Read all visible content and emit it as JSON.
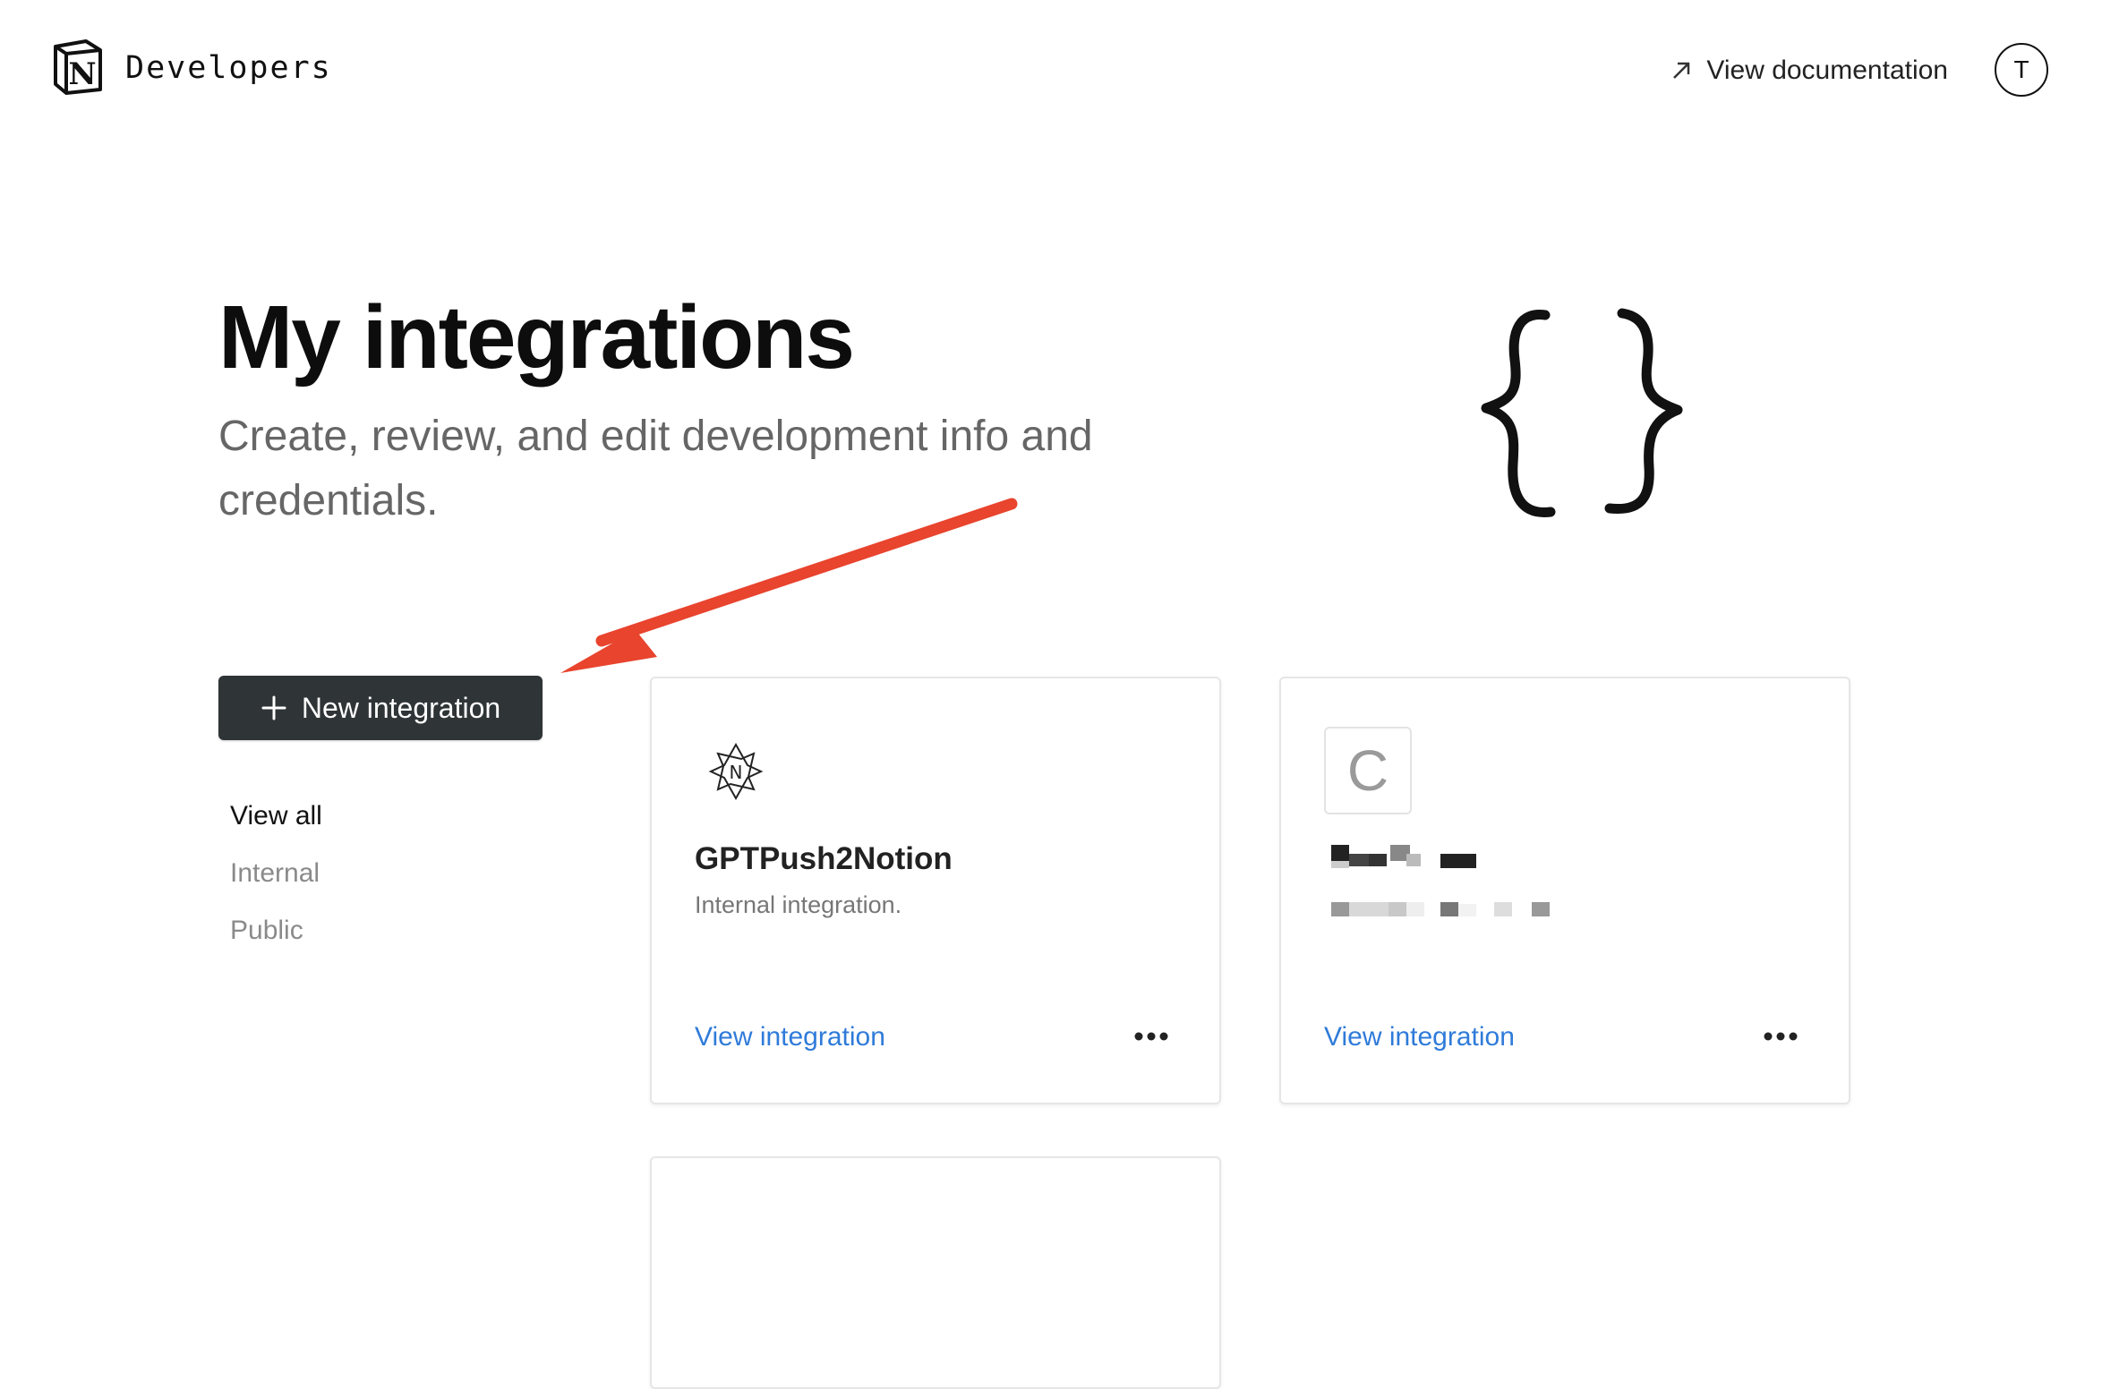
{
  "header": {
    "brand": "Developers",
    "doc_link": "View documentation",
    "avatar_letter": "T"
  },
  "hero": {
    "title": "My integrations",
    "subtitle": "Create, review, and edit development info and credentials."
  },
  "actions": {
    "new_integration": "New integration"
  },
  "filters": [
    {
      "label": "View all",
      "active": true
    },
    {
      "label": "Internal",
      "active": false
    },
    {
      "label": "Public",
      "active": false
    }
  ],
  "integrations": [
    {
      "name": "GPTPush2Notion",
      "description": "Internal integration.",
      "link": "View integration",
      "icon": "notion-star-icon"
    },
    {
      "letter": "C",
      "link": "View integration",
      "icon": "letter-c-icon"
    }
  ],
  "colors": {
    "primary_button": "#2f3437",
    "link": "#2f7bd9",
    "annotation_arrow": "#e8442e"
  }
}
